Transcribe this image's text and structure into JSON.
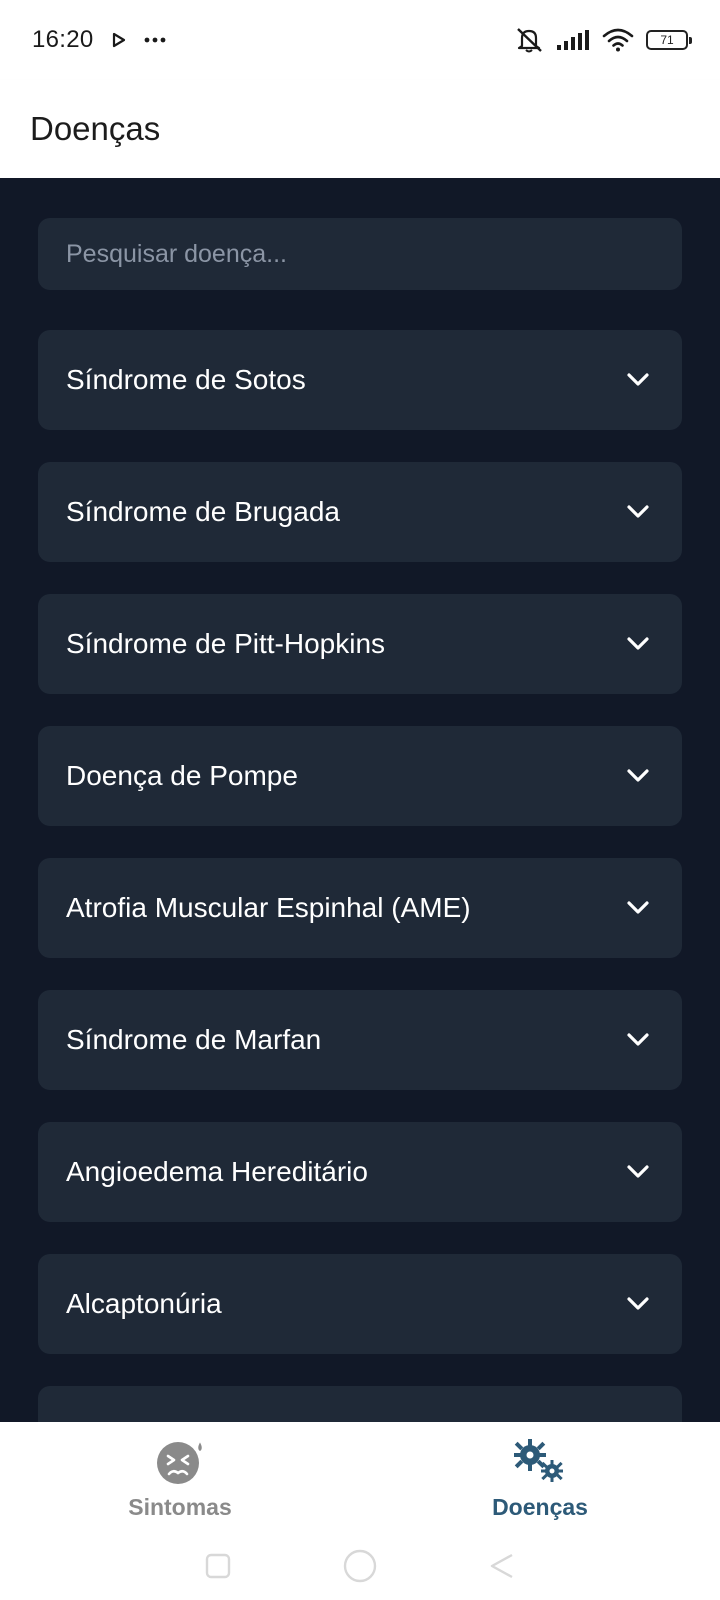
{
  "status_bar": {
    "time": "16:20",
    "battery": "71",
    "icons": [
      "play-icon",
      "more-dots-icon",
      "mute-icon",
      "signal-icon",
      "wifi-icon",
      "battery-icon"
    ]
  },
  "header": {
    "title": "Doenças"
  },
  "search": {
    "placeholder": "Pesquisar doença...",
    "value": ""
  },
  "diseases": [
    {
      "name": "Síndrome de Sotos"
    },
    {
      "name": "Síndrome de Brugada"
    },
    {
      "name": "Síndrome de Pitt-Hopkins"
    },
    {
      "name": "Doença de Pompe"
    },
    {
      "name": "Atrofia Muscular Espinhal (AME)"
    },
    {
      "name": "Síndrome de Marfan"
    },
    {
      "name": "Angioedema Hereditário"
    },
    {
      "name": "Alcaptonúria"
    },
    {
      "name": ""
    }
  ],
  "bottom_nav": {
    "tabs": [
      {
        "label": "Sintomas",
        "icon": "sick-face-icon",
        "active": false
      },
      {
        "label": "Doenças",
        "icon": "virus-icon",
        "active": true
      }
    ]
  },
  "colors": {
    "background": "#111827",
    "card": "#1f2937",
    "active_tab": "#2d5a78",
    "inactive_tab": "#8a8a8a"
  }
}
